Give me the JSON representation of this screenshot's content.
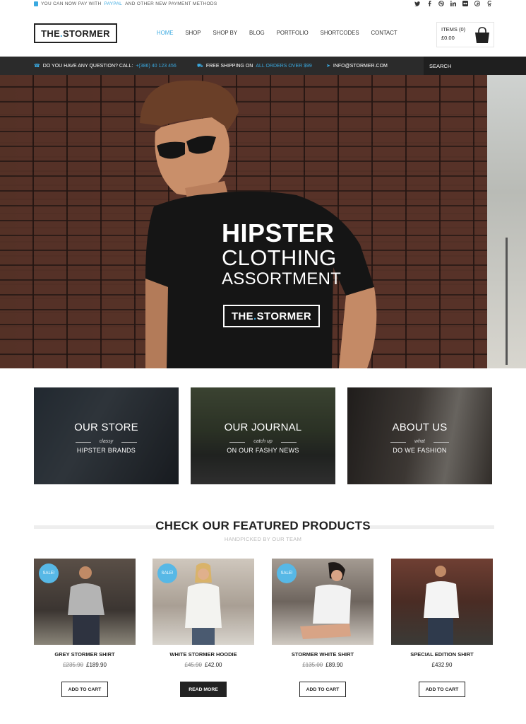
{
  "promo_bar": {
    "text_before": "YOU CAN NOW PAY WITH",
    "highlight": "PAYPAL",
    "text_after": "AND OTHER NEW PAYMENT METHODS",
    "social_icons": [
      "twitter-icon",
      "facebook-icon",
      "dribbble-icon",
      "linkedin-icon",
      "flickr-icon",
      "pinterest-icon",
      "google-plus-icon"
    ]
  },
  "header": {
    "logo_left": "THE",
    "logo_dot": ".",
    "logo_right": "STORMER",
    "nav": [
      "HOME",
      "SHOP",
      "SHOP BY",
      "BLOG",
      "PORTFOLIO",
      "SHORTCODES",
      "CONTACT"
    ],
    "active_nav": "HOME",
    "cart_items": "ITEMS (0)",
    "cart_total": "£0.00"
  },
  "info_bar": {
    "question_label": "DO YOU HAVE ANY QUESTION? CALL:",
    "phone": "+(386) 40 123 456",
    "shipping_text": "FREE SHIPPING ON",
    "shipping_highlight": "ALL ORDERS OVER $99",
    "email": "INFO@STORMER.COM",
    "search_placeholder": "SEARCH"
  },
  "hero": {
    "line1": "HIPSTER",
    "line2": "CLOTHING",
    "line3": "ASSORTMENT",
    "button_left": "THE",
    "button_dot": ".",
    "button_right": "STORMER"
  },
  "tiles": [
    {
      "title": "OUR STORE",
      "sub": "classy",
      "cta": "HIPSTER BRANDS"
    },
    {
      "title": "OUR JOURNAL",
      "sub": "catch up",
      "cta": "ON OUR FASHY NEWS"
    },
    {
      "title": "ABOUT US",
      "sub": "what",
      "cta": "DO WE FASHION"
    }
  ],
  "featured": {
    "title": "CHECK OUR FEATURED PRODUCTS",
    "subtitle": "HANDPICKED BY OUR TEAM"
  },
  "products": [
    {
      "name": "GREY STORMER SHIRT",
      "old_price": "£235.90",
      "price": "£189.90",
      "sale": "SALE!",
      "button": "ADD TO CART"
    },
    {
      "name": "WHITE STORMER HOODIE",
      "old_price": "£45.90",
      "price": "£42.00",
      "sale": "SALE!",
      "button": "READ MORE"
    },
    {
      "name": "STORMER WHITE SHIRT",
      "old_price": "£135.00",
      "price": "£89.90",
      "sale": "SALE!",
      "button": "ADD TO CART"
    },
    {
      "name": "SPECIAL EDITION SHIRT",
      "old_price": "",
      "price": "£432.90",
      "sale": "",
      "button": "ADD TO CART"
    }
  ],
  "colors": {
    "accent": "#3aa9e0",
    "dark_bar": "#2b2b2b"
  }
}
